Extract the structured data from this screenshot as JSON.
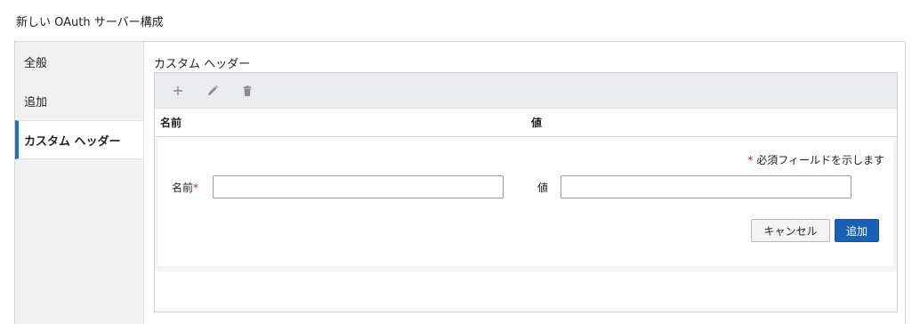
{
  "page": {
    "title": "新しい OAuth サーバー構成"
  },
  "sidebar": {
    "items": [
      {
        "label": "全般",
        "active": false
      },
      {
        "label": "追加",
        "active": false
      },
      {
        "label": "カスタム ヘッダー",
        "active": true
      }
    ]
  },
  "section": {
    "title": "カスタム ヘッダー"
  },
  "toolbar": {
    "buttons": [
      {
        "icon": "plus-icon"
      },
      {
        "icon": "pencil-icon"
      },
      {
        "icon": "trash-icon"
      }
    ]
  },
  "table": {
    "columns": [
      "名前",
      "値"
    ]
  },
  "form": {
    "required_note": "必須フィールドを示します",
    "required_marker": "*",
    "name_label": "名前",
    "name_value": "",
    "value_label": "値",
    "value_value": "",
    "cancel_label": "キャンセル",
    "add_label": "追加"
  },
  "colors": {
    "accent": "#1f6fc5",
    "primary_button": "#1a60b5",
    "required": "#c4262e"
  }
}
